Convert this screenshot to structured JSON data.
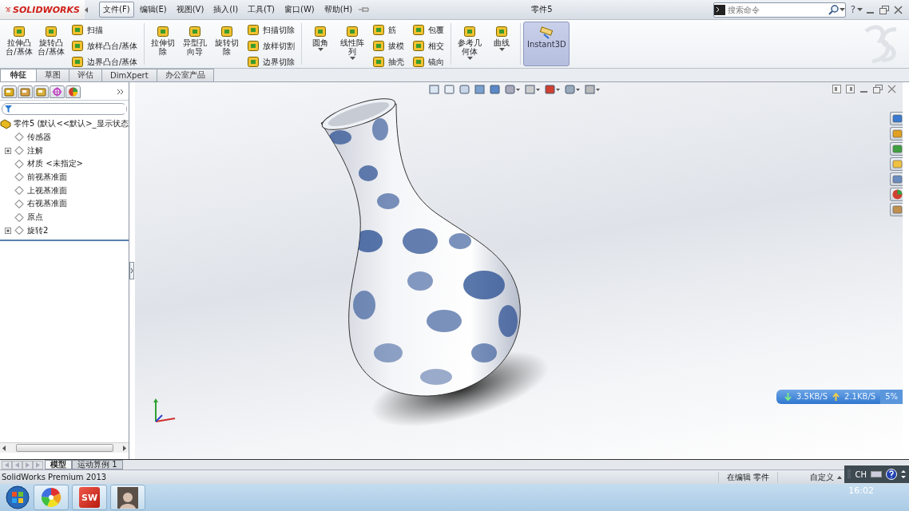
{
  "app": {
    "logo": "SOLIDWORKS",
    "title": "零件5",
    "help": "?",
    "search": {
      "placeholder": "搜索命令"
    },
    "menus": [
      {
        "label": "文件(F)",
        "selected": true
      },
      {
        "label": "编辑(E)",
        "selected": false
      },
      {
        "label": "视图(V)",
        "selected": false
      },
      {
        "label": "插入(I)",
        "selected": false
      },
      {
        "label": "工具(T)",
        "selected": false
      },
      {
        "label": "窗口(W)",
        "selected": false
      },
      {
        "label": "帮助(H)",
        "selected": false
      }
    ]
  },
  "ribbon": {
    "columns": [
      {
        "kind": "large",
        "label": "拉伸凸台/基体",
        "dropdown": false,
        "on": false
      },
      {
        "kind": "large",
        "label": "旋转凸台/基体",
        "dropdown": false,
        "on": false
      },
      {
        "kind": "stack",
        "items": [
          "扫描",
          "放样凸台/基体",
          "边界凸台/基体"
        ]
      },
      {
        "kind": "separator"
      },
      {
        "kind": "large",
        "label": "拉伸切除",
        "dropdown": false,
        "on": false
      },
      {
        "kind": "large",
        "label": "异型孔向导",
        "dropdown": false,
        "on": false
      },
      {
        "kind": "large",
        "label": "旋转切除",
        "dropdown": false,
        "on": false
      },
      {
        "kind": "stack",
        "items": [
          "扫描切除",
          "放样切割",
          "边界切除"
        ]
      },
      {
        "kind": "separator"
      },
      {
        "kind": "large",
        "label": "圆角",
        "dropdown": true,
        "on": false
      },
      {
        "kind": "large",
        "label": "线性阵列",
        "dropdown": true,
        "on": false
      },
      {
        "kind": "stack",
        "items": [
          "筋",
          "拔模",
          "抽壳"
        ]
      },
      {
        "kind": "stack",
        "items": [
          "包覆",
          "相交",
          "镜向"
        ]
      },
      {
        "kind": "separator"
      },
      {
        "kind": "large",
        "label": "参考几何体",
        "dropdown": true,
        "on": false
      },
      {
        "kind": "large",
        "label": "曲线",
        "dropdown": true,
        "on": false
      },
      {
        "kind": "separator"
      },
      {
        "kind": "large",
        "label": "Instant3D",
        "dropdown": false,
        "on": true
      }
    ]
  },
  "command_tabs": [
    {
      "label": "特征",
      "selected": true
    },
    {
      "label": "草图",
      "selected": false
    },
    {
      "label": "评估",
      "selected": false
    },
    {
      "label": "DimXpert",
      "selected": false
    },
    {
      "label": "办公室产品",
      "selected": false
    }
  ],
  "tree": {
    "label": "零件5  (默认<<默认>_显示状态",
    "children": [
      {
        "label": "传感器",
        "collapsed": false
      },
      {
        "label": "注解",
        "collapsed": true
      },
      {
        "label": "材质 <未指定>",
        "collapsed": false
      },
      {
        "label": "前视基准面",
        "collapsed": false
      },
      {
        "label": "上视基准面",
        "collapsed": false
      },
      {
        "label": "右视基准面",
        "collapsed": false
      },
      {
        "label": "原点",
        "collapsed": false
      },
      {
        "label": "旋转2",
        "collapsed": true
      }
    ]
  },
  "bottom_tabs": [
    {
      "label": "模型",
      "selected": true
    },
    {
      "label": "运动算例 1",
      "selected": false
    }
  ],
  "network_meter": {
    "download": "3.5KB/S",
    "upload": "2.1KB/S",
    "cpu": "5%"
  },
  "status_bar": {
    "product": "SolidWorks Premium 2013",
    "mode": "在编辑 零件",
    "customize": "自定义"
  },
  "language_bar": {
    "language": "CH"
  },
  "taskbar": {
    "app_badge": "SW",
    "time": "16:02"
  }
}
